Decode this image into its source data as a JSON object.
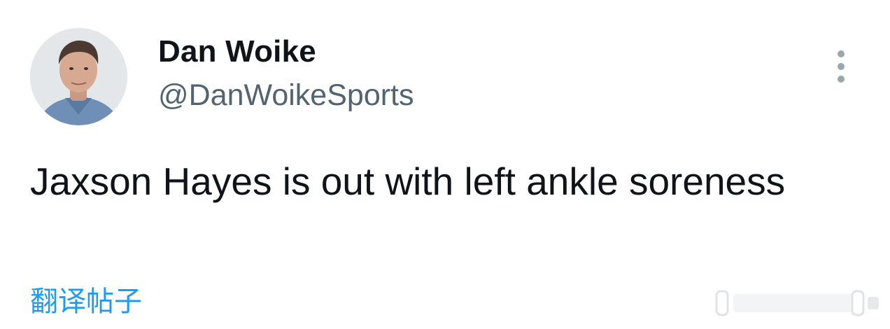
{
  "author": {
    "display_name": "Dan Woike",
    "handle": "@DanWoikeSports",
    "avatar_icon": "profile-photo"
  },
  "tweet": {
    "text": "Jaxson Hayes is out with left ankle soreness"
  },
  "actions": {
    "translate_label": "翻译帖子",
    "more_icon": "more-vertical-icon"
  },
  "colors": {
    "text_primary": "#0f1419",
    "text_secondary": "#536471",
    "link": "#1d9bf0"
  }
}
